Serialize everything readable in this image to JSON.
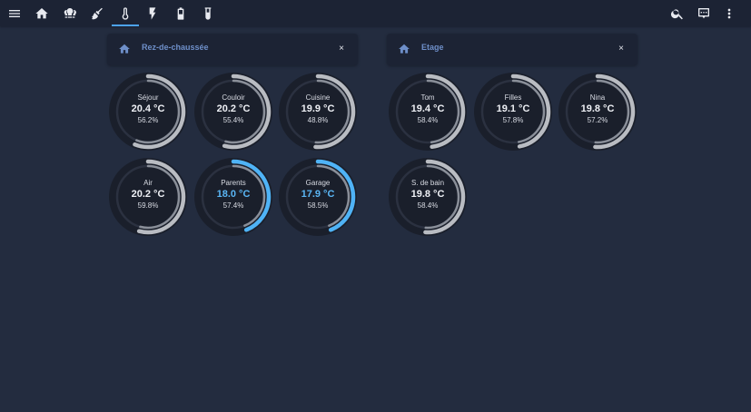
{
  "colors": {
    "background": "#232c3f",
    "topbar": "#1c2334",
    "accent": "#4da3f0",
    "gauge_normal": "#b9bcc2",
    "gauge_cold": "#4fb3f6",
    "gauge_track": "#181d29",
    "header_title": "#6e8fc9"
  },
  "topbar": {
    "left_icons": [
      "menu-icon",
      "home-icon",
      "lightbulb-group-icon",
      "broom-icon",
      "thermometer-icon",
      "flash-icon",
      "battery-icon",
      "test-tube-icon"
    ],
    "active_tab": "thermometer-icon",
    "right_icons": [
      "search-icon",
      "assist-icon",
      "more-vertical-icon"
    ]
  },
  "cards": [
    {
      "title": "Rez-de-chaussée",
      "icon": "home-icon",
      "close": "×",
      "gauges": [
        {
          "name": "Séjour",
          "temp": "20.4 °C",
          "humidity": "56.2%",
          "level": 0.56,
          "cold": false
        },
        {
          "name": "Couloir",
          "temp": "20.2 °C",
          "humidity": "55.4%",
          "level": 0.54,
          "cold": false
        },
        {
          "name": "Cuisine",
          "temp": "19.9 °C",
          "humidity": "48.8%",
          "level": 0.51,
          "cold": false
        },
        {
          "name": "Air",
          "temp": "20.2 °C",
          "humidity": "59.8%",
          "level": 0.54,
          "cold": false
        },
        {
          "name": "Parents",
          "temp": "18.0 °C",
          "humidity": "57.4%",
          "level": 0.44,
          "cold": true
        },
        {
          "name": "Garage",
          "temp": "17.9 °C",
          "humidity": "58.5%",
          "level": 0.44,
          "cold": true
        }
      ]
    },
    {
      "title": "Etage",
      "icon": "home-icon",
      "close": "×",
      "gauges": [
        {
          "name": "Tom",
          "temp": "19.4 °C",
          "humidity": "58.4%",
          "level": 0.48,
          "cold": false
        },
        {
          "name": "Filles",
          "temp": "19.1 °C",
          "humidity": "57.8%",
          "level": 0.47,
          "cold": false
        },
        {
          "name": "Nina",
          "temp": "19.8 °C",
          "humidity": "57.2%",
          "level": 0.51,
          "cold": false
        },
        {
          "name": "S. de bain",
          "temp": "19.8 °C",
          "humidity": "58.4%",
          "level": 0.51,
          "cold": false
        }
      ]
    }
  ]
}
